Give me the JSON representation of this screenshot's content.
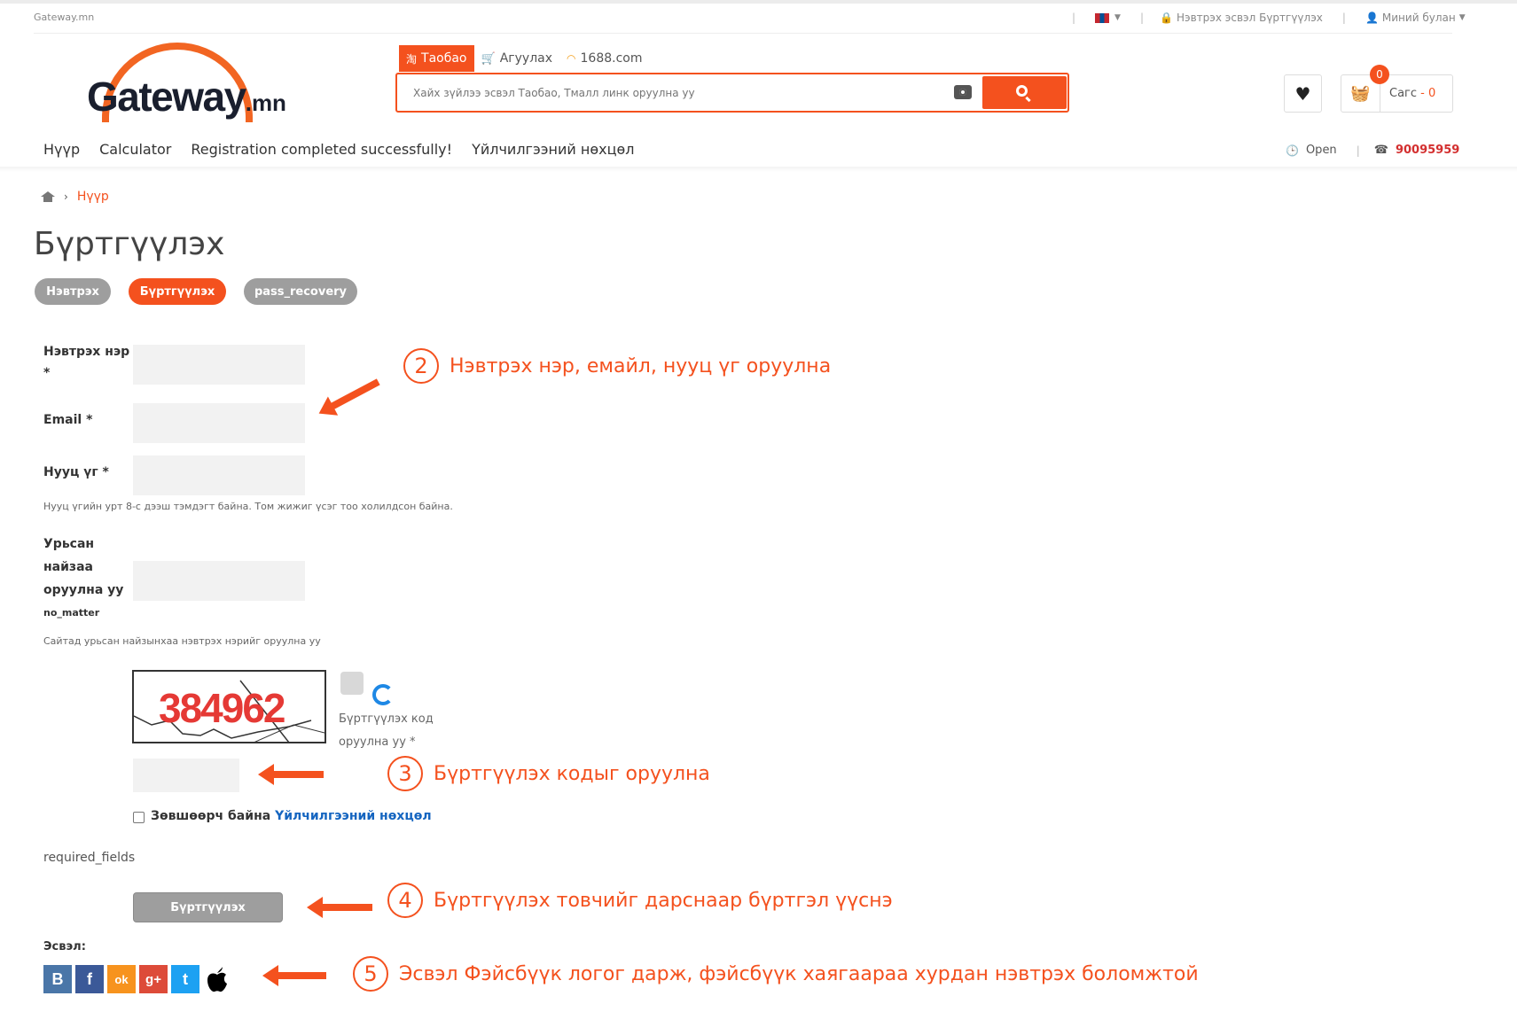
{
  "header": {
    "site_name": "Gateway.mn",
    "login_register": "Нэвтрэх эсвэл Бүртгүүлэх",
    "my_account": "Миний булан",
    "logo_main": "Gateway",
    "logo_suffix": ".mn"
  },
  "search": {
    "tabs": [
      "Таобао",
      "Агуулах",
      "1688.com"
    ],
    "placeholder": "Хайх зүйлээ эсвэл Таобао, Тмалл линк оруулна уу"
  },
  "cart": {
    "label": "Сагс",
    "amount": "- 0",
    "badge": "0"
  },
  "nav": {
    "items": [
      "Нүүр",
      "Calculator",
      "Registration completed successfully!",
      "Үйлчилгээний нөхцөл"
    ],
    "status": "Open",
    "phone": "90095959"
  },
  "breadcrumb": {
    "current": "Нүүр"
  },
  "page": {
    "title": "Бүртгүүлэх",
    "pills": [
      "Нэвтрэх",
      "Бүртгүүлэх",
      "pass_recovery"
    ]
  },
  "form": {
    "username_label": "Нэвтрэх нэр",
    "required_mark": "*",
    "email_label": "Email *",
    "password_label": "Нууц үг *",
    "password_hint": "Нууц үгийн урт 8-с дээш тэмдэгт байна. Том жижиг үсэг тоо холилдсон байна.",
    "referral_label_1": "Урьсан",
    "referral_label_2": "найзаа",
    "referral_label_3": "оруулна уу",
    "referral_sub": "no_matter",
    "referral_hint": "Сайтад урьсан найзынхаа нэвтрэх нэрийг оруулна уу",
    "captcha_text": "384962",
    "captcha_label_1": "Бүртгүүлэх код",
    "captcha_label_2": "оруулна уу *",
    "agree_text": "Зөвшөөрч байна",
    "agree_link": "Үйлчилгээний нөхцөл",
    "required_fields": "required_fields",
    "submit": "Бүртгүүлэх",
    "or_label": "Эсвэл:"
  },
  "social": [
    "В",
    "f",
    "ok",
    "g+",
    "t",
    ""
  ],
  "annotations": {
    "a2_num": "2",
    "a2_text": "Нэвтрэх нэр, емайл, нууц үг оруулна",
    "a3_num": "3",
    "a3_text": "Бүртгүүлэх кодыг оруулна",
    "a4_num": "4",
    "a4_text": "Бүртгүүлэх товчийг дарснаар бүртгэл үүснэ",
    "a5_num": "5",
    "a5_text": "Эсвэл Фэйсбүүк логог дарж, фэйсбүүк хаягаараа хурдан нэвтрэх боломжтой"
  },
  "colors": {
    "accent": "#f4511e",
    "link": "#1565c0",
    "phone": "#d32f2f",
    "disabled": "#9e9e9e"
  }
}
